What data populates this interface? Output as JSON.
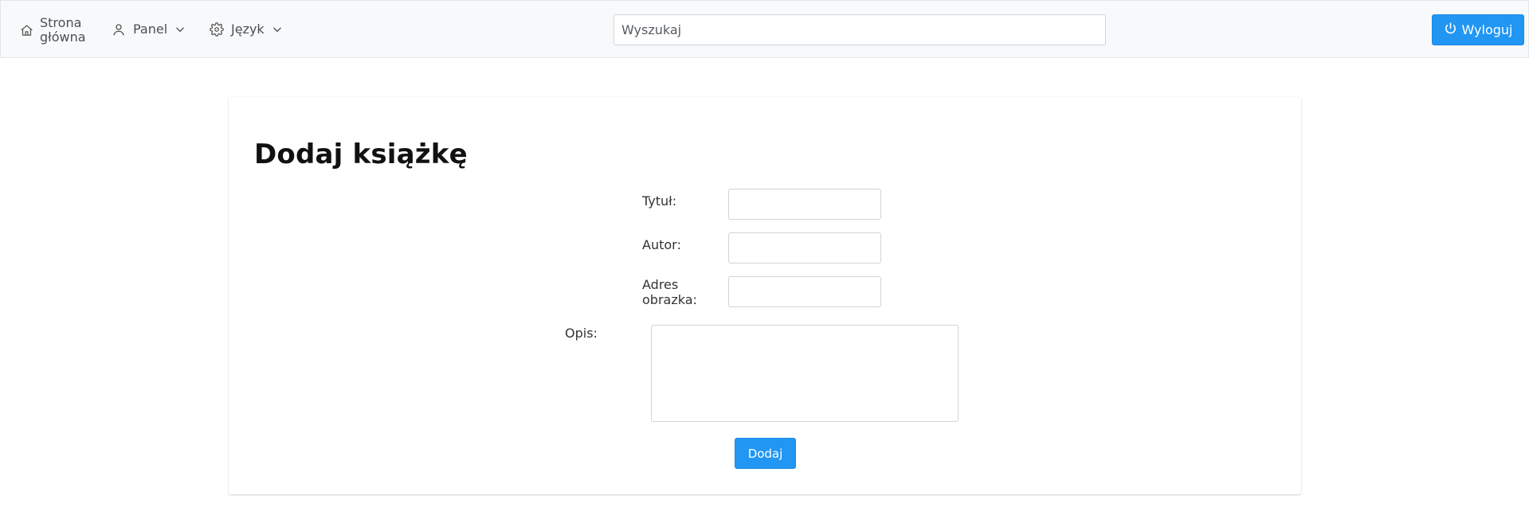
{
  "navbar": {
    "home": {
      "label": "Strona główna",
      "icon": "home-icon"
    },
    "panel": {
      "label": "Panel",
      "icon": "user-icon",
      "caret": "chevron-down-icon"
    },
    "language": {
      "label": "Język",
      "icon": "gear-icon",
      "caret": "chevron-down-icon"
    },
    "search": {
      "placeholder": "Wyszukaj",
      "value": ""
    },
    "logout": {
      "label": "Wyloguj",
      "icon": "power-icon"
    }
  },
  "form": {
    "title": "Dodaj książkę",
    "fields": {
      "title_label": "Tytuł:",
      "author_label": "Autor:",
      "image_label": "Adres obrazka:",
      "description_label": "Opis:"
    },
    "submit_label": "Dodaj"
  },
  "colors": {
    "accent": "#2196f3",
    "navbar_bg": "#f8f9fa",
    "border": "#ced4da"
  }
}
